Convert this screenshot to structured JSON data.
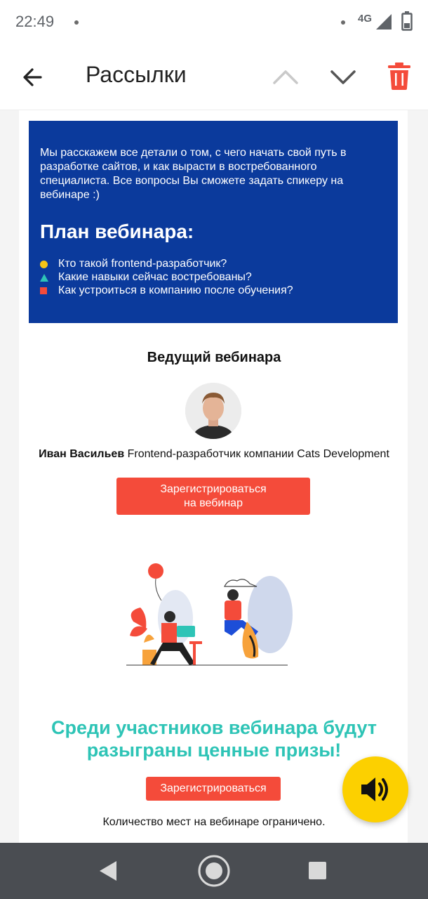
{
  "status_bar": {
    "time": "22:49",
    "network": "4G",
    "icons": [
      "notification-dot",
      "signal-icon",
      "battery-icon"
    ]
  },
  "app_bar": {
    "title": "Рассылки",
    "icons": [
      "back-arrow-icon",
      "chevron-up-icon",
      "chevron-down-icon",
      "trash-icon"
    ],
    "accent": "#f44b3a"
  },
  "email": {
    "intro": "Мы расскажем все детали о том, с чего начать свой путь в разработке сайтов, и как вырасти в востребованного специалиста. Все вопросы Вы сможете задать спикеру на вебинаре :)",
    "plan_title": "План вебинара:",
    "plan_items": [
      {
        "label": "Кто такой frontend-разработчик?",
        "marker": "circle",
        "color": "#f5c518"
      },
      {
        "label": "Какие навыки сейчас востребованы?",
        "marker": "triangle",
        "color": "#2ec4b6"
      },
      {
        "label": "Как устроиться в компанию после обучения?",
        "marker": "square",
        "color": "#f44b3a"
      }
    ],
    "host_title": "Ведущий вебинара",
    "host_name": "Иван Васильев",
    "host_role": "Frontend-разработчик компании Cats Development",
    "register_button_line1": "Зарегистрироваться",
    "register_button_line2": "на вебинар",
    "prize_line1": "Среди участников вебинара будут",
    "prize_line2": "разыграны ценные призы!",
    "register_button_small": "Зарегистрироваться",
    "limited_text": "Количество мест на вебинаре ограничено.",
    "colors": {
      "blue_block": "#0b3a9c",
      "cta": "#f44b3a",
      "prize_text": "#2ec4b6",
      "fab": "#fcd000"
    }
  },
  "fab": {
    "icon": "speaker-icon"
  },
  "nav_bar": {
    "icons": [
      "nav-back-icon",
      "nav-home-icon",
      "nav-recents-icon"
    ]
  }
}
